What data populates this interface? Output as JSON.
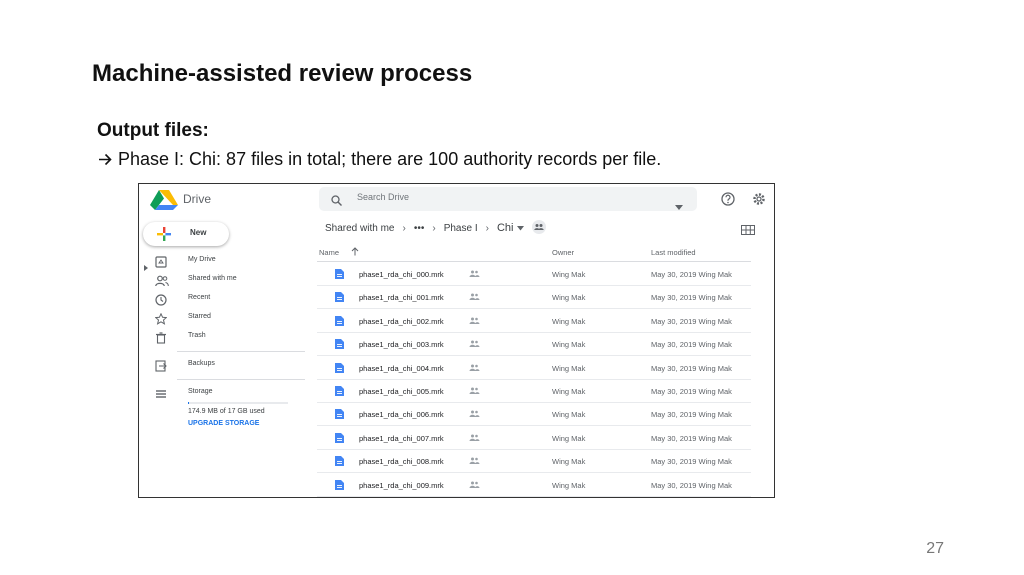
{
  "slide": {
    "title": "Machine-assisted review process",
    "subheading": "Output files:",
    "bullet": "Phase I: Chi: 87 files in total; there are 100 authority records per file.",
    "page_number": "27"
  },
  "drive": {
    "app_name": "Drive",
    "search_placeholder": "Search Drive",
    "new_label": "New",
    "sidebar": {
      "items": [
        {
          "label": "My Drive",
          "icon": "my-drive-icon"
        },
        {
          "label": "Shared with me",
          "icon": "people-icon"
        },
        {
          "label": "Recent",
          "icon": "clock-icon"
        },
        {
          "label": "Starred",
          "icon": "star-icon"
        },
        {
          "label": "Trash",
          "icon": "trash-icon"
        },
        {
          "label": "Backups",
          "icon": "backup-icon"
        },
        {
          "label": "Storage",
          "icon": "storage-icon"
        }
      ],
      "storage_used": "174.9 MB of 17 GB used",
      "storage_fraction": 0.01,
      "upgrade_label": "UPGRADE STORAGE"
    },
    "breadcrumb": {
      "root": "Shared with me",
      "ellipsis": "•••",
      "parent": "Phase I",
      "current": "Chi"
    },
    "list": {
      "headers": {
        "name": "Name",
        "owner": "Owner",
        "modified": "Last modified"
      },
      "rows": [
        {
          "name": "phase1_rda_chi_000.mrk",
          "owner": "Wing Mak",
          "modified": "May 30, 2019 Wing Mak"
        },
        {
          "name": "phase1_rda_chi_001.mrk",
          "owner": "Wing Mak",
          "modified": "May 30, 2019 Wing Mak"
        },
        {
          "name": "phase1_rda_chi_002.mrk",
          "owner": "Wing Mak",
          "modified": "May 30, 2019 Wing Mak"
        },
        {
          "name": "phase1_rda_chi_003.mrk",
          "owner": "Wing Mak",
          "modified": "May 30, 2019 Wing Mak"
        },
        {
          "name": "phase1_rda_chi_004.mrk",
          "owner": "Wing Mak",
          "modified": "May 30, 2019 Wing Mak"
        },
        {
          "name": "phase1_rda_chi_005.mrk",
          "owner": "Wing Mak",
          "modified": "May 30, 2019 Wing Mak"
        },
        {
          "name": "phase1_rda_chi_006.mrk",
          "owner": "Wing Mak",
          "modified": "May 30, 2019 Wing Mak"
        },
        {
          "name": "phase1_rda_chi_007.mrk",
          "owner": "Wing Mak",
          "modified": "May 30, 2019 Wing Mak"
        },
        {
          "name": "phase1_rda_chi_008.mrk",
          "owner": "Wing Mak",
          "modified": "May 30, 2019 Wing Mak"
        },
        {
          "name": "phase1_rda_chi_009.mrk",
          "owner": "Wing Mak",
          "modified": "May 30, 2019 Wing Mak"
        }
      ]
    },
    "colors": {
      "file_blue": "#4285f4",
      "accent_blue": "#1a73e8"
    }
  }
}
